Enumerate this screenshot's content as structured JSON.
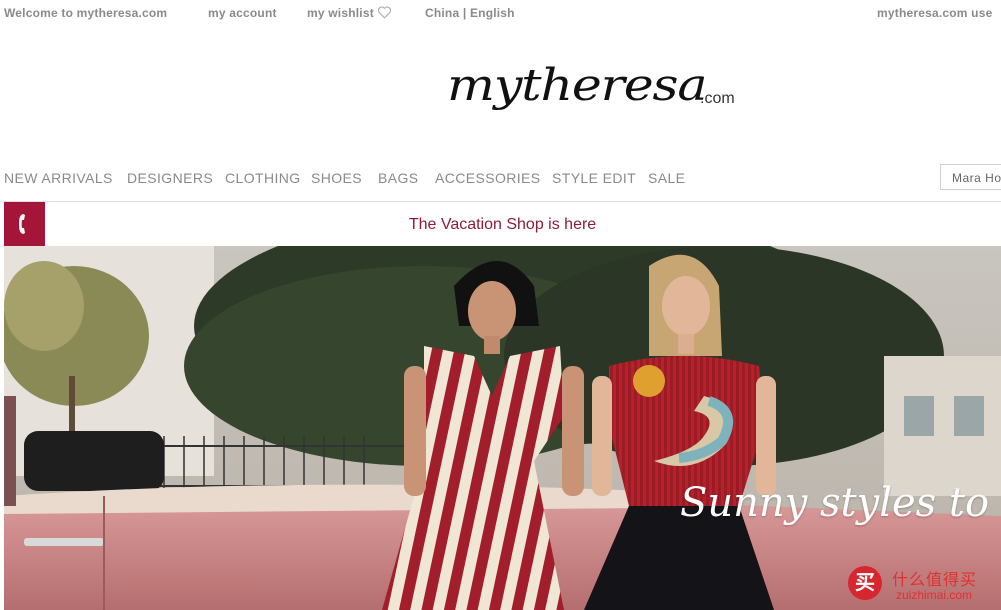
{
  "topbar": {
    "welcome": "Welcome to mytheresa.com",
    "account": "my account",
    "wishlist": "my wishlist",
    "region": "China | English",
    "right_link": "mytheresa.com use"
  },
  "logo": {
    "script": "mytheresa",
    "suffix": ".com"
  },
  "nav": {
    "items": [
      "NEW ARRIVALS",
      "DESIGNERS",
      "CLOTHING",
      "SHOES",
      "BAGS",
      "ACCESSORIES",
      "STYLE EDIT",
      "SALE"
    ]
  },
  "search": {
    "value": "Mara Ho"
  },
  "promo": {
    "text": "The Vacation Shop is here",
    "icon": "phone-icon"
  },
  "hero": {
    "headline": "Sunny styles to we"
  },
  "watermark": {
    "badge": "买",
    "brand": "什么值得买",
    "site": "zuizhimai.com"
  },
  "colors": {
    "accent": "#a3163a",
    "promo_text": "#8c1c3a",
    "nav_text": "#8a8a8a"
  }
}
